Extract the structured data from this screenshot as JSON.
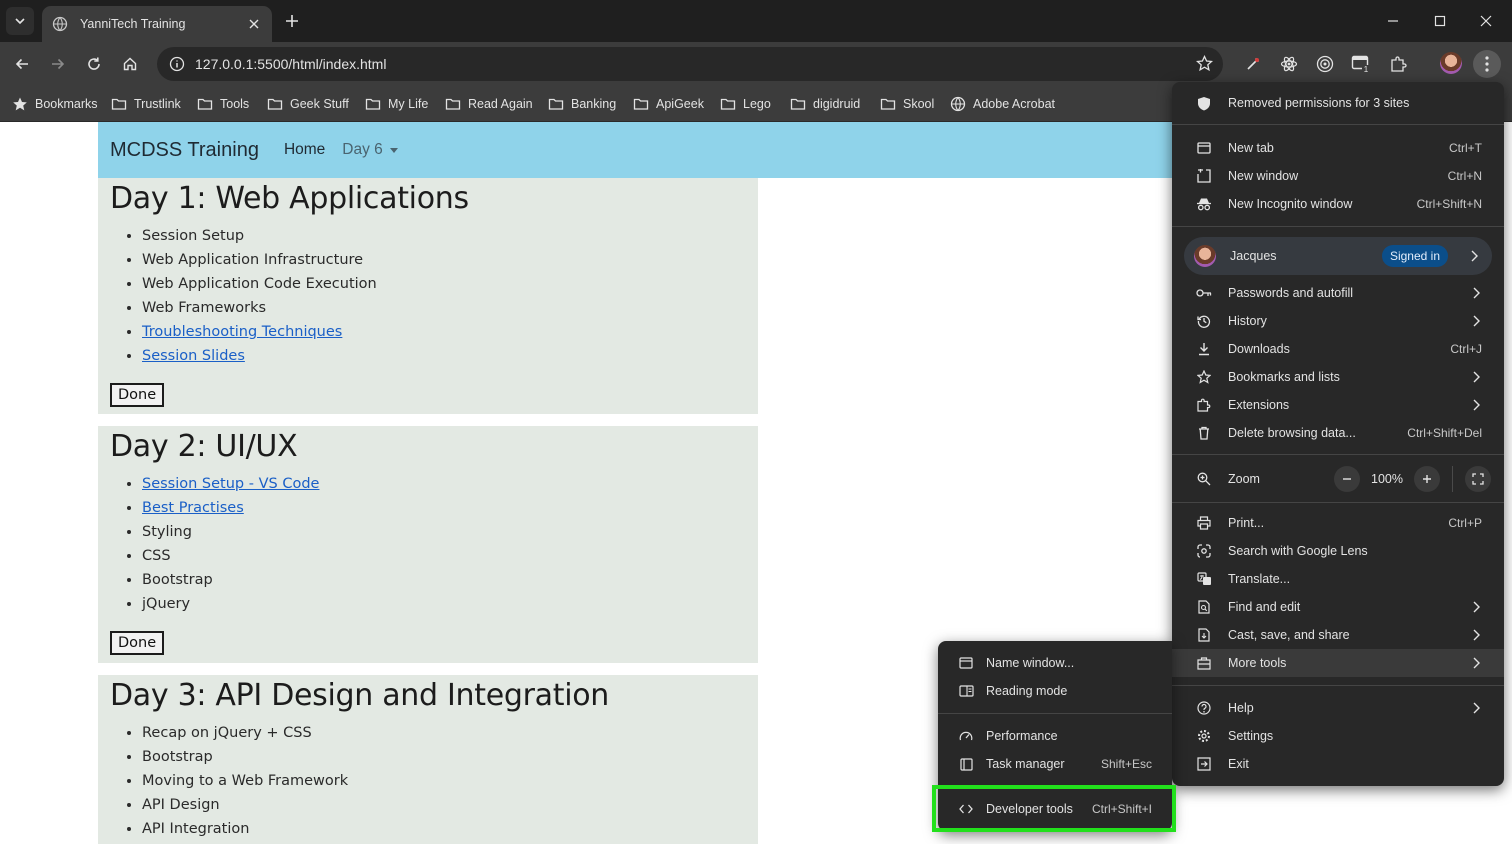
{
  "browser": {
    "tab_title": "YanniTech Training",
    "url": "127.0.0.1:5500/html/index.html",
    "bookmarks": [
      "Bookmarks",
      "Trustlink",
      "Tools",
      "Geek Stuff",
      "My Life",
      "Read Again",
      "Banking",
      "ApiGeek",
      "Lego",
      "digidruid",
      "Skool",
      "Adobe Acrobat"
    ]
  },
  "site": {
    "brand": "MCDSS Training",
    "nav_home": "Home",
    "nav_dropdown": "Day 6"
  },
  "days": [
    {
      "title": "Day 1: Web Applications",
      "items": [
        {
          "text": "Session Setup",
          "link": false
        },
        {
          "text": "Web Application Infrastructure",
          "link": false
        },
        {
          "text": "Web Application Code Execution",
          "link": false
        },
        {
          "text": "Web Frameworks",
          "link": false
        },
        {
          "text": "Troubleshooting Techniques",
          "link": true
        },
        {
          "text": "Session Slides",
          "link": true
        }
      ],
      "button": "Done"
    },
    {
      "title": "Day 2: UI/UX",
      "items": [
        {
          "text": "Session Setup - VS Code",
          "link": true
        },
        {
          "text": "Best Practises",
          "link": true
        },
        {
          "text": "Styling",
          "link": false
        },
        {
          "text": "CSS",
          "link": false
        },
        {
          "text": "Bootstrap",
          "link": false
        },
        {
          "text": "jQuery",
          "link": false
        }
      ],
      "button": "Done"
    },
    {
      "title": "Day 3: API Design and Integration",
      "items": [
        {
          "text": "Recap on jQuery + CSS",
          "link": false
        },
        {
          "text": "Bootstrap",
          "link": false
        },
        {
          "text": "Moving to a Web Framework",
          "link": false
        },
        {
          "text": "API Design",
          "link": false
        },
        {
          "text": "API Integration",
          "link": false
        }
      ]
    }
  ],
  "menu": {
    "permissions_notice": "Removed permissions for 3 sites",
    "new_tab": "New tab",
    "new_tab_sc": "Ctrl+T",
    "new_window": "New window",
    "new_window_sc": "Ctrl+N",
    "incognito": "New Incognito window",
    "incognito_sc": "Ctrl+Shift+N",
    "profile_name": "Jacques",
    "profile_status": "Signed in",
    "passwords": "Passwords and autofill",
    "history": "History",
    "downloads": "Downloads",
    "downloads_sc": "Ctrl+J",
    "bookmarks": "Bookmarks and lists",
    "extensions": "Extensions",
    "delete_data": "Delete browsing data...",
    "delete_data_sc": "Ctrl+Shift+Del",
    "zoom": "Zoom",
    "zoom_value": "100%",
    "print": "Print...",
    "print_sc": "Ctrl+P",
    "lens": "Search with Google Lens",
    "translate": "Translate...",
    "find": "Find and edit",
    "cast": "Cast, save, and share",
    "more_tools": "More tools",
    "help": "Help",
    "settings": "Settings",
    "exit": "Exit"
  },
  "submenu": {
    "name_window": "Name window...",
    "reading_mode": "Reading mode",
    "performance": "Performance",
    "task_manager": "Task manager",
    "task_manager_sc": "Shift+Esc",
    "dev_tools": "Developer tools",
    "dev_tools_sc": "Ctrl+Shift+I"
  },
  "colors": {
    "navbar": "#8fd3ea",
    "card": "#e3e9e3",
    "link": "#1a5fc7",
    "highlight": "#22e01c",
    "menu_bg": "#282828"
  }
}
